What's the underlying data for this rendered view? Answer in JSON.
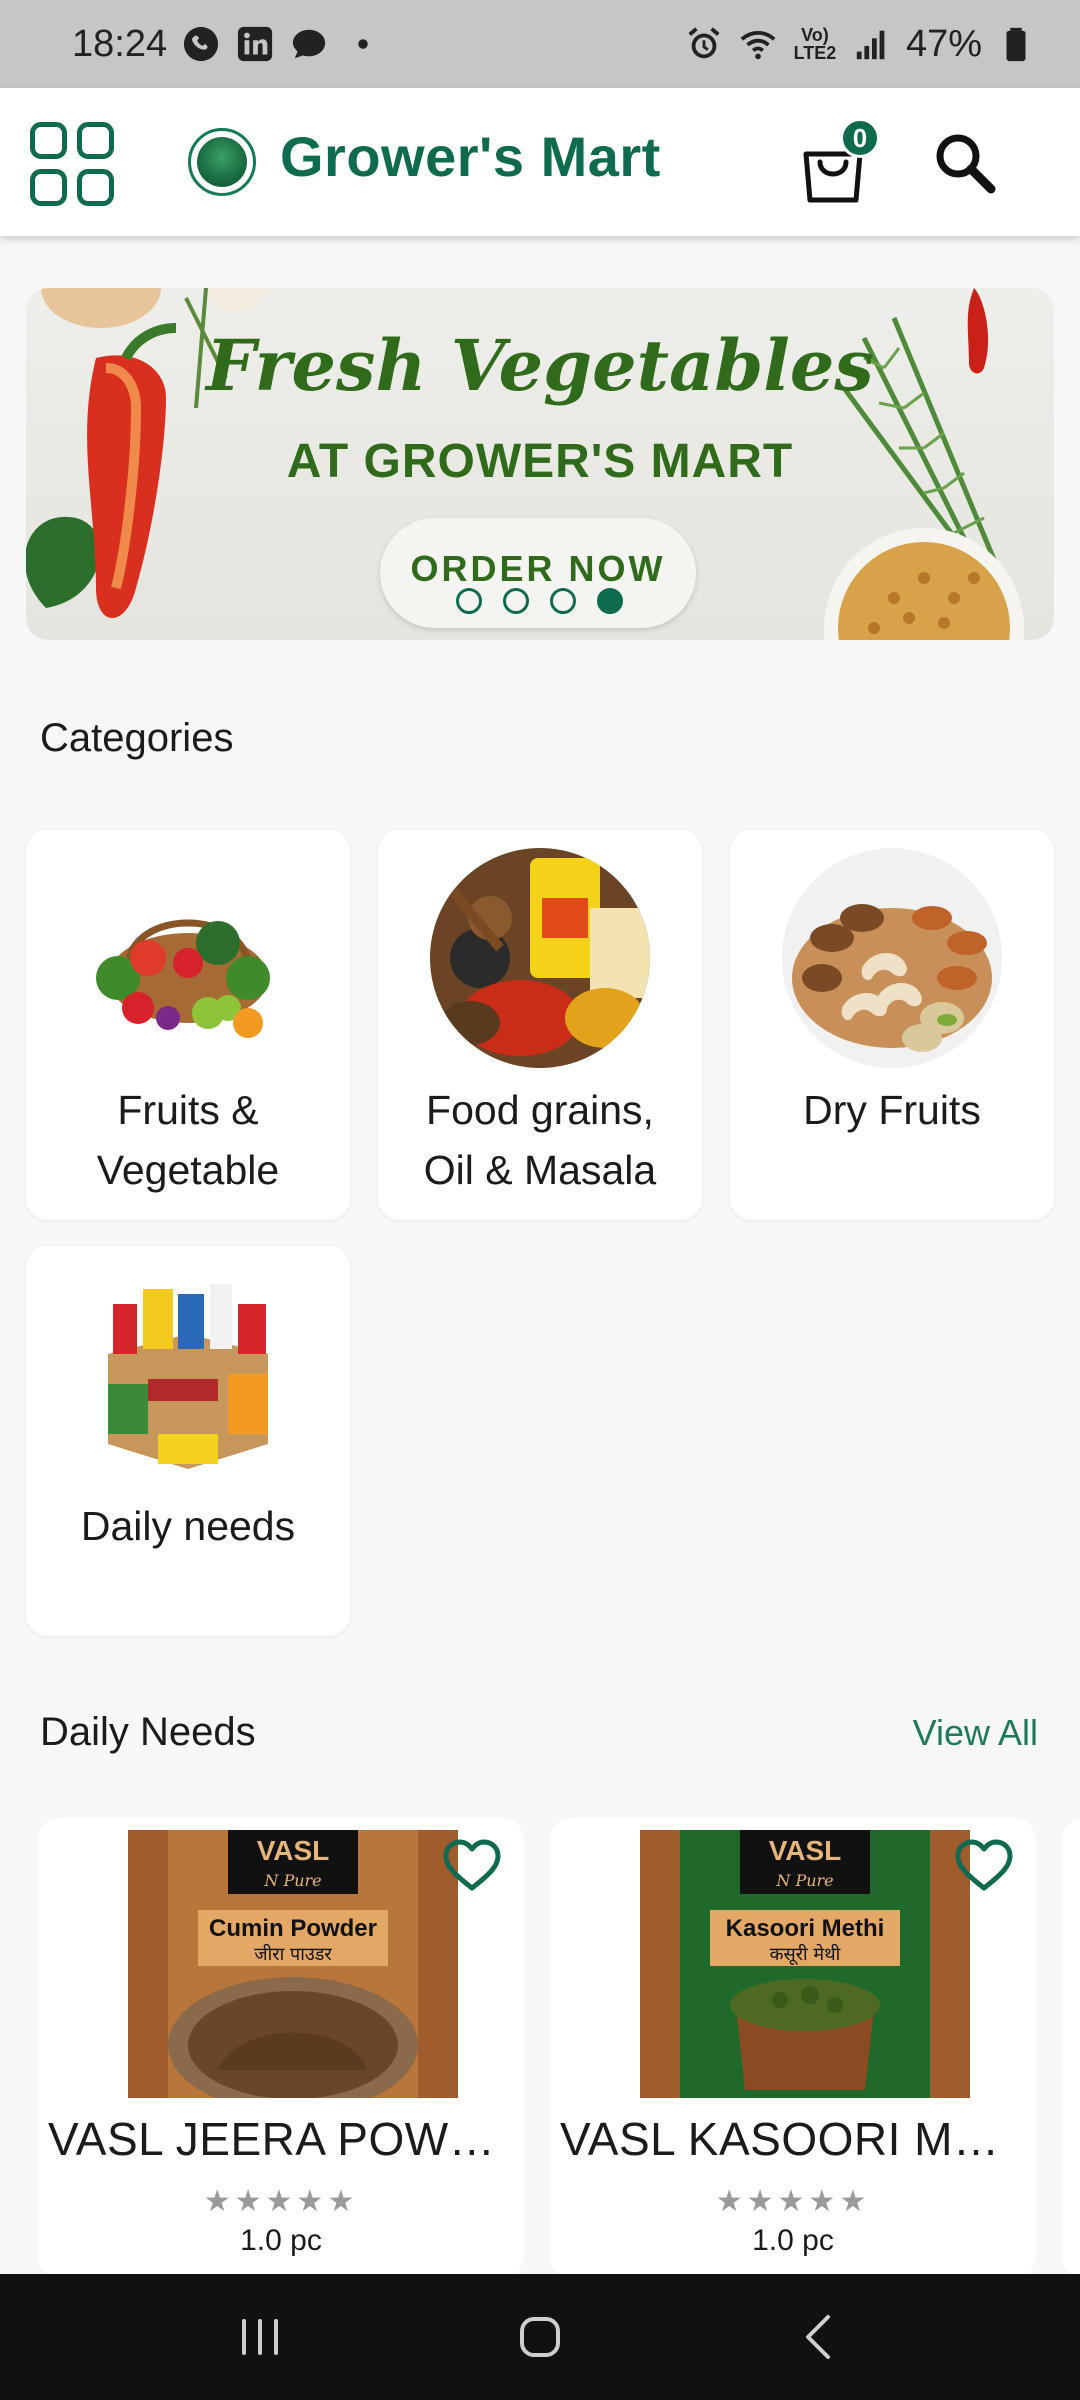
{
  "status_bar": {
    "time": "18:24",
    "battery": "47%",
    "network_label": "Vo) LTE2"
  },
  "app_bar": {
    "title": "Grower's Mart",
    "cart_count": "0"
  },
  "banner": {
    "title": "Fresh Vegetables",
    "subtitle": "AT GROWER'S MART",
    "cta": "ORDER NOW",
    "slide_count": 4,
    "active_slide": 4
  },
  "categories": {
    "heading": "Categories",
    "items": [
      {
        "label": "Fruits & Vegetable"
      },
      {
        "label": "Food grains, Oil & Masala"
      },
      {
        "label": "Dry Fruits"
      },
      {
        "label": "Daily needs"
      }
    ]
  },
  "daily_needs": {
    "heading": "Daily Needs",
    "view_all": "View All",
    "products": [
      {
        "name": "VASL JEERA POWDER",
        "qty": "1.0 pc",
        "stars": "★★★★★",
        "pack_brand": "VASL",
        "pack_sub": "N Pure",
        "pack_title": "Cumin Powder",
        "pack_hindi": "जीरा पाउडर"
      },
      {
        "name": "VASL KASOORI METHI",
        "qty": "1.0 pc",
        "stars": "★★★★★",
        "pack_brand": "VASL",
        "pack_sub": "N Pure",
        "pack_title": "Kasoori Methi",
        "pack_hindi": "कसूरी मेथी"
      }
    ]
  },
  "colors": {
    "brand": "#0f6b50",
    "banner_text": "#2f6b1a",
    "status_bar_bg": "#c6c6c6",
    "nav_bar_bg": "#111111"
  },
  "icons": {
    "menu": "grid-icon",
    "cart": "shopping-bag-icon",
    "search": "search-icon",
    "favorite": "heart-outline-icon",
    "nav": [
      "recent-apps-icon",
      "home-icon",
      "back-icon"
    ]
  }
}
